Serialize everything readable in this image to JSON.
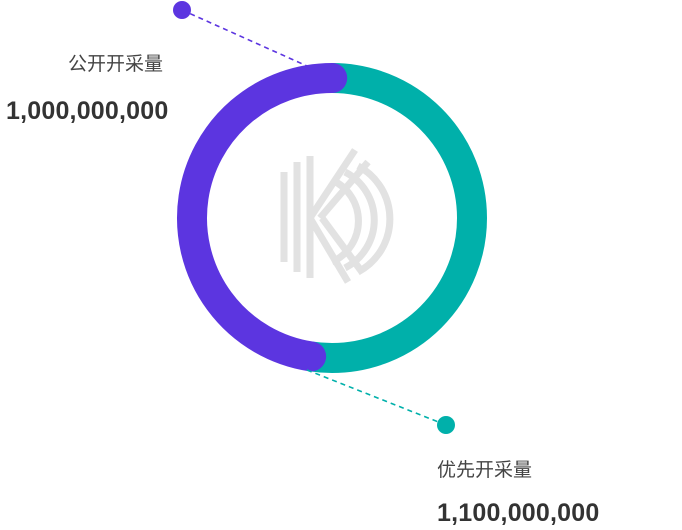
{
  "chart_data": {
    "type": "pie",
    "donut": true,
    "series": [
      {
        "name": "公开开采量",
        "value": 1000000000,
        "value_label": "1,000,000,000",
        "color": "#5c35e0"
      },
      {
        "name": "优先开采量",
        "value": 1100000000,
        "value_label": "1,100,000,000",
        "color": "#00b0aa"
      }
    ],
    "center_icon": "kp-logo-icon",
    "legend": "callouts"
  }
}
